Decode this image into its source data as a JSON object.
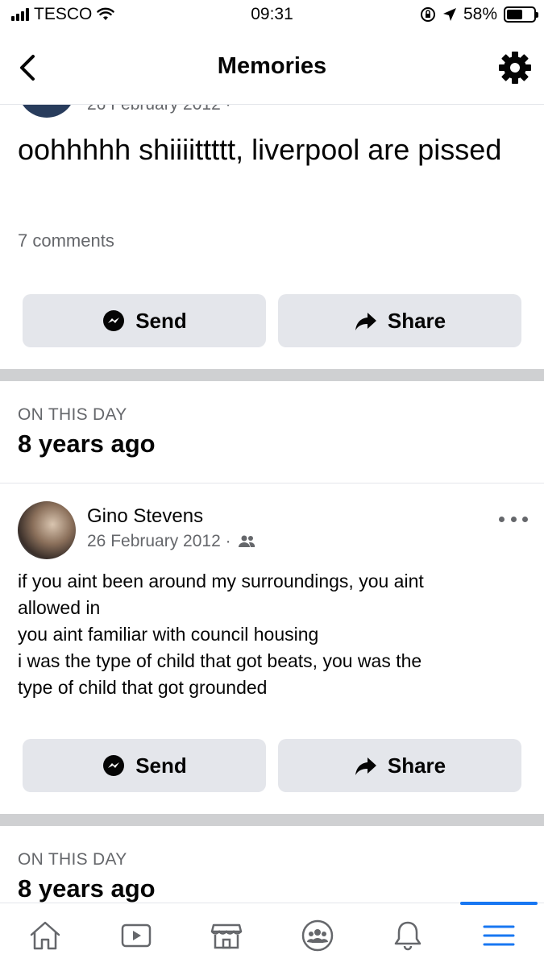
{
  "status_bar": {
    "carrier": "TESCO",
    "time": "09:31",
    "battery": "58%",
    "battery_level": 0.58
  },
  "nav": {
    "title": "Memories",
    "back_icon": "chevron-left-icon",
    "settings_icon": "gear-icon"
  },
  "post1": {
    "date_partial": "26 February 2012 ·",
    "text": "oohhhhh shiiiittttt, liverpool are pissed",
    "comments": "7 comments",
    "send_label": "Send",
    "share_label": "Share"
  },
  "section2": {
    "label": "ON THIS DAY",
    "heading": "8 years ago"
  },
  "post2": {
    "author": "Gino Stevens",
    "date": "26 February 2012 ·",
    "body_lines": [
      "if you aint been around my surroundings, you aint",
      "allowed in",
      "you aint familiar with council housing",
      "i was the type of child that got beats, you was the",
      "type of child that got grounded"
    ],
    "send_label": "Send",
    "share_label": "Share"
  },
  "section3": {
    "label": "ON THIS DAY",
    "heading": "8 years ago"
  },
  "tabs": [
    {
      "icon": "home-icon"
    },
    {
      "icon": "video-icon"
    },
    {
      "icon": "marketplace-icon"
    },
    {
      "icon": "groups-icon"
    },
    {
      "icon": "bell-icon"
    },
    {
      "icon": "menu-icon",
      "active": true
    }
  ],
  "colors": {
    "accent": "#1877f2",
    "button_bg": "#e4e6eb",
    "secondary_text": "#65676b",
    "divider": "#cfd0d2"
  }
}
